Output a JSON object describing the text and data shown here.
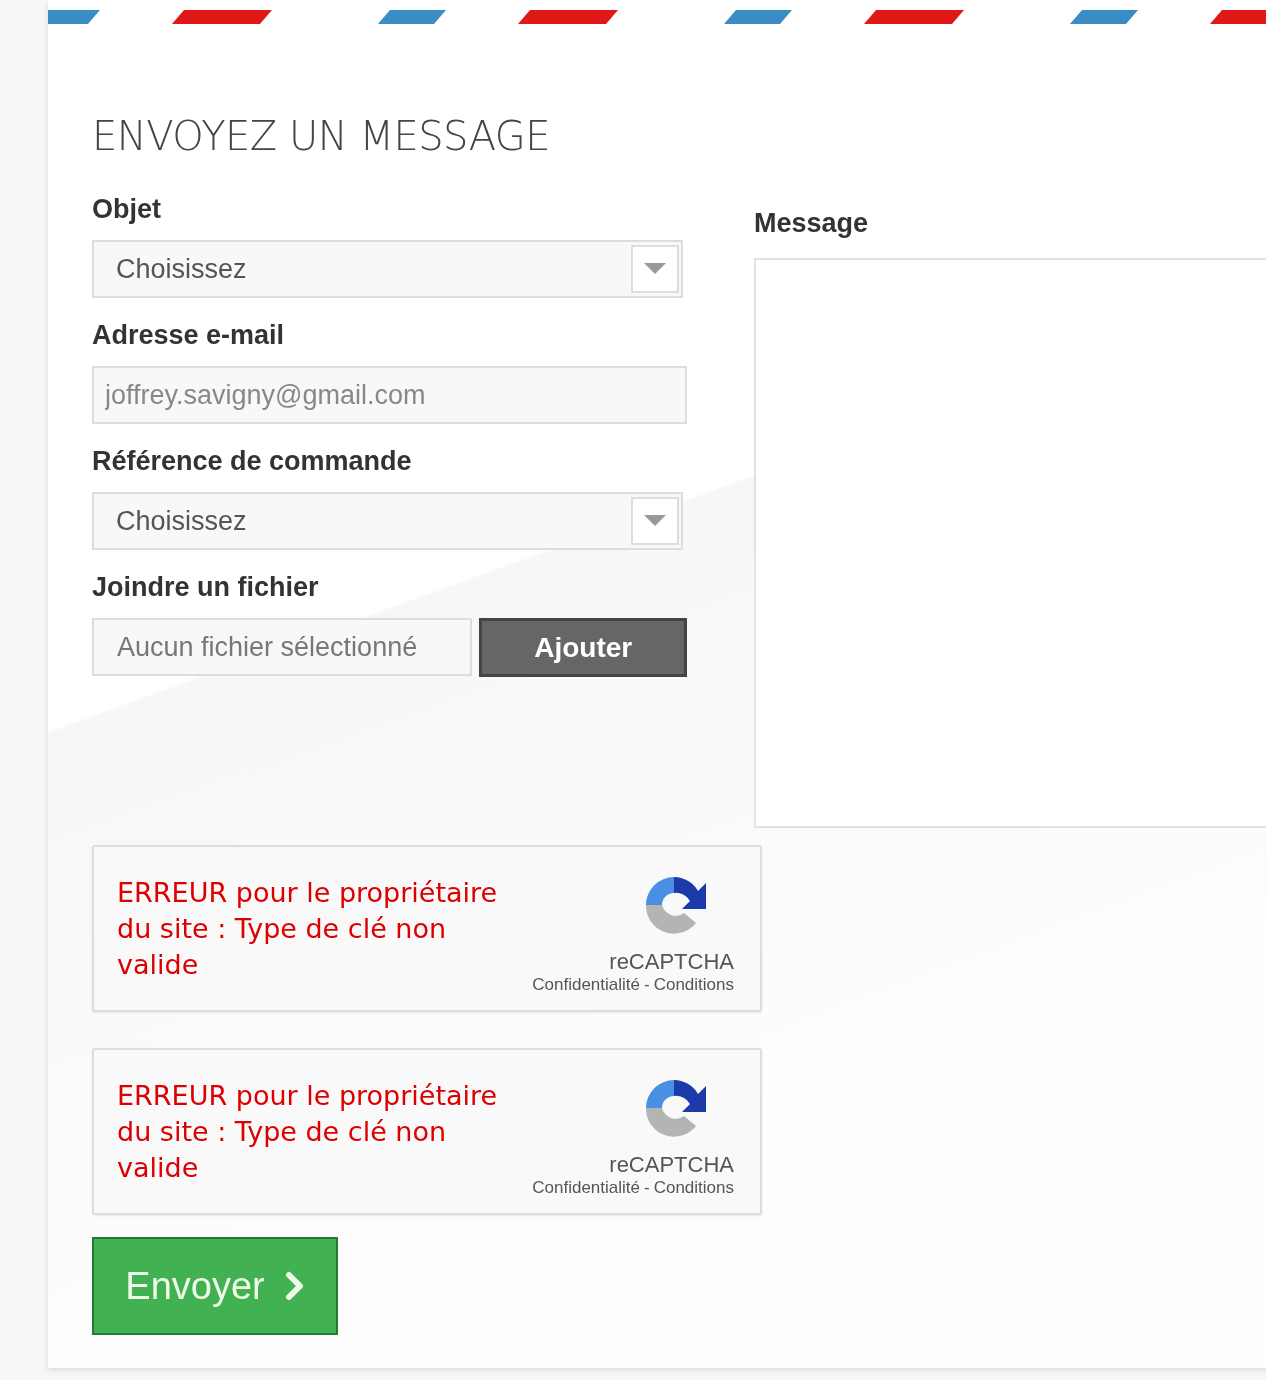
{
  "title": "ENVOYEZ UN MESSAGE",
  "fields": [
    {
      "kind": "select",
      "label": "Objet",
      "value": "Choisissez"
    },
    {
      "kind": "email",
      "label": "Adresse e-mail",
      "value": "joffrey.savigny@gmail.com"
    },
    {
      "kind": "select",
      "label": "Référence de commande",
      "value": "Choisissez"
    },
    {
      "kind": "file",
      "label": "Joindre un fichier",
      "value": "Aucun fichier sélectionné",
      "button": "Ajouter"
    }
  ],
  "message": {
    "label": "Message"
  },
  "captchas": [
    {
      "error": "ERREUR pour le propriétaire du site : Type de clé non valide",
      "brand": "reCAPTCHA",
      "privacy": "Confidentialité",
      "separator": "-",
      "terms": "Conditions"
    },
    {
      "error": "ERREUR pour le propriétaire du site : Type de clé non valide",
      "brand": "reCAPTCHA",
      "privacy": "Confidentialité",
      "separator": "-",
      "terms": "Conditions"
    }
  ],
  "submit": {
    "label": "Envoyer"
  }
}
